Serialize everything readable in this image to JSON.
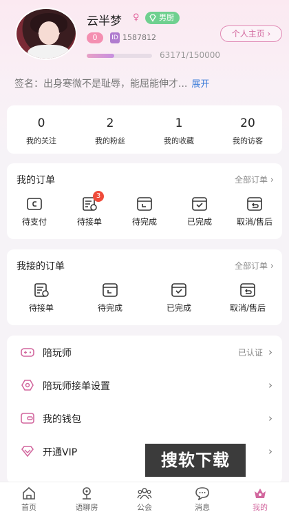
{
  "profile": {
    "name": "云半梦",
    "gender_symbol": "♀",
    "role_badge": "男厨",
    "profile_button": "个人主页 ›",
    "level": "0",
    "id_tag": "ID",
    "id_number": "1587812",
    "xp_text": "63171/150000",
    "xp_progress": 0.42,
    "signature": "签名：出身寒微不是耻辱，能屈能伸才...",
    "expand": "展开"
  },
  "stats": [
    {
      "num": "0",
      "label": "我的关注"
    },
    {
      "num": "2",
      "label": "我的粉丝"
    },
    {
      "num": "1",
      "label": "我的收藏"
    },
    {
      "num": "20",
      "label": "我的访客"
    }
  ],
  "my_orders": {
    "title": "我的订单",
    "more": "全部订单",
    "items": [
      {
        "label": "待支付",
        "icon": "wallet-icon"
      },
      {
        "label": "待接单",
        "icon": "order-list-icon",
        "badge": "3"
      },
      {
        "label": "待完成",
        "icon": "pending-box-icon"
      },
      {
        "label": "已完成",
        "icon": "check-box-icon"
      },
      {
        "label": "取消/售后",
        "icon": "return-box-icon"
      }
    ]
  },
  "received_orders": {
    "title": "我接的订单",
    "more": "全部订单",
    "items": [
      {
        "label": "待接单",
        "icon": "order-list-icon"
      },
      {
        "label": "待完成",
        "icon": "pending-box-icon"
      },
      {
        "label": "已完成",
        "icon": "check-box-icon"
      },
      {
        "label": "取消/售后",
        "icon": "return-box-icon"
      }
    ]
  },
  "menu": [
    {
      "label": "陪玩师",
      "right": "已认证",
      "icon": "gamepad-icon"
    },
    {
      "label": "陪玩师接单设置",
      "right": "",
      "icon": "settings-icon"
    },
    {
      "label": "我的钱包",
      "right": "",
      "icon": "wallet-icon"
    },
    {
      "label": "开通VIP",
      "right": "",
      "icon": "vip-diamond-icon"
    }
  ],
  "watermark": "搜软下载",
  "tabs": [
    {
      "label": "首页",
      "icon": "home-icon"
    },
    {
      "label": "语聊房",
      "icon": "voice-room-icon"
    },
    {
      "label": "公会",
      "icon": "guild-icon"
    },
    {
      "label": "消息",
      "icon": "message-icon"
    },
    {
      "label": "我的",
      "icon": "me-icon",
      "active": true
    }
  ],
  "colors": {
    "accent": "#d2679e",
    "badge_red": "#ef4b3a",
    "link_blue": "#3b7cd9",
    "icon_gray": "#333333"
  }
}
